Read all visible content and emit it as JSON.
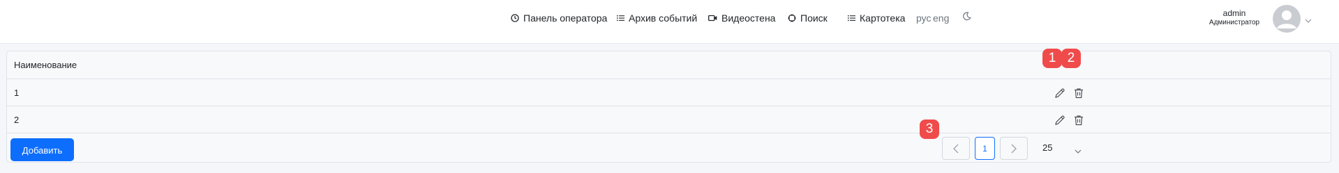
{
  "nav": {
    "operator_panel": "Панель оператора",
    "event_archive": "Архив событий",
    "video_wall": "Видеостена",
    "search": "Поиск",
    "card_index": "Картотека"
  },
  "lang": {
    "ru": "рус",
    "en": "eng"
  },
  "user": {
    "name": "admin",
    "role": "Администратор"
  },
  "table": {
    "header": "Наименование",
    "rows": [
      "1",
      "2"
    ],
    "add_button": "Добавить"
  },
  "pagination": {
    "current_page": "1",
    "per_page": "25"
  },
  "badges": [
    "1",
    "2",
    "3"
  ],
  "colors": {
    "accent": "#0d6efd",
    "badge": "#f04b4b",
    "background": "#f4f6f9"
  },
  "icons": [
    "clock-icon",
    "list-icon",
    "video-icon",
    "search-crosshair-icon",
    "list-icon",
    "moon-icon",
    "avatar-icon",
    "chevron-down-icon",
    "pencil-icon",
    "trash-icon",
    "chevron-left-icon",
    "chevron-right-icon"
  ]
}
